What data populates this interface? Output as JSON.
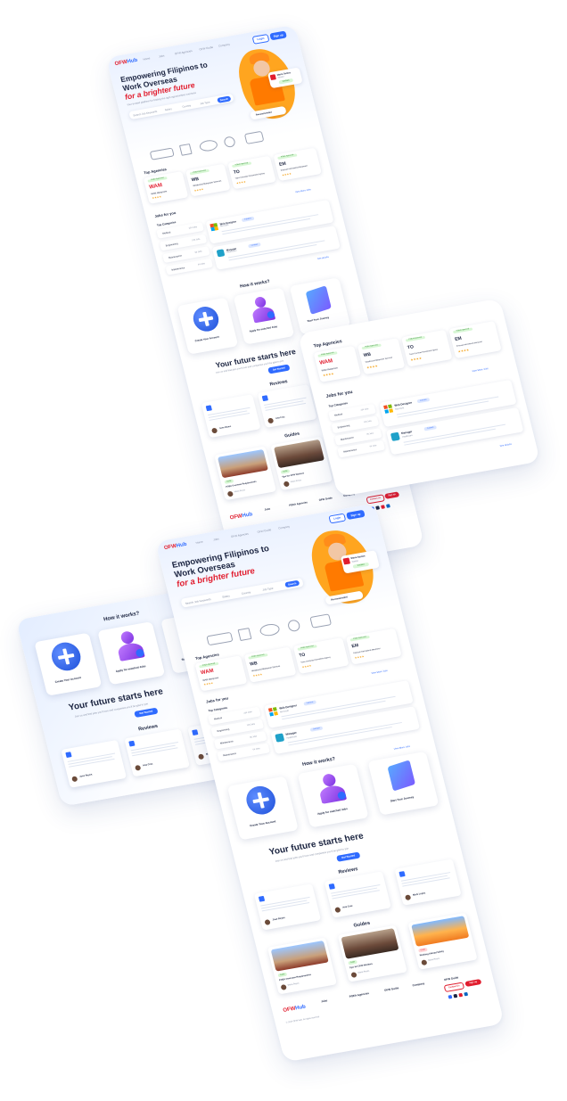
{
  "site": {
    "logo_text_a": "OFW",
    "logo_text_b": "Hub",
    "nav": [
      "Home",
      "Jobs",
      "OFW Agencies",
      "OFW Guide",
      "Company"
    ],
    "login_label": "Login",
    "signup_label": "Sign up"
  },
  "hero": {
    "title_line1": "Empowering Filipinos to",
    "title_line2": "Work Overseas",
    "title_line3": "for a brighter future",
    "subtitle": "Your trusted platform for finding the right opportunities overseas",
    "search_placeholder": "Search Job Keywords",
    "search_filters": [
      "Salary",
      "Country",
      "Job Type"
    ],
    "search_button": "Search",
    "profile_card_name": "Maria Santos",
    "profile_card_role": "Welder",
    "profile_card_tag": "Verified",
    "recommended_label": "Recommended"
  },
  "top_agencies": {
    "heading": "Top Agencies",
    "agencies": [
      {
        "name": "WAM Manpower",
        "tag": "POEA Approved",
        "rating": "4.8",
        "logo": "WAM"
      },
      {
        "name": "Westbound Manpower Services",
        "tag": "POEA Approved",
        "rating": "4.7",
        "logo": "WB"
      },
      {
        "name": "Trans Overseas Recruitment Agency",
        "tag": "POEA Approved",
        "rating": "4.6",
        "logo": "TO"
      },
      {
        "name": "Emanuel International Manpower",
        "tag": "POEA Approved",
        "rating": "4.5",
        "logo": "EM"
      }
    ]
  },
  "jobs": {
    "heading": "Jobs for you",
    "view_more": "View More Jobs",
    "categories_heading": "Top Categories",
    "categories": [
      {
        "name": "Medical",
        "count": "234 Jobs"
      },
      {
        "name": "Engineering",
        "count": "128 Jobs"
      },
      {
        "name": "Maintenance",
        "count": "96 Jobs"
      },
      {
        "name": "Maintenance",
        "count": "64 Jobs"
      }
    ],
    "listings": [
      {
        "title": "Web Designer",
        "company": "Microsoft",
        "tag": "Full-time"
      },
      {
        "title": "Manager",
        "company": "Healthcare",
        "tag": "Contract"
      }
    ],
    "see_all": "See all jobs"
  },
  "how": {
    "heading": "How it works?",
    "steps": [
      "Create Your Account",
      "Apply for matched Jobs",
      "Start Your Journey"
    ]
  },
  "future": {
    "heading": "Your future starts here",
    "subheading": "Join us and find jobs you'll love and companies you'll be glad to join",
    "button": "Get Started"
  },
  "reviews": {
    "heading": "Reviews",
    "items": [
      {
        "author": "Jose Reyes",
        "role": "OFW"
      },
      {
        "author": "Ana Cruz",
        "role": "OFW"
      },
      {
        "author": "Mark Lopez",
        "role": "OFW"
      }
    ]
  },
  "guides": {
    "heading": "Guides",
    "items": [
      {
        "title": "POEA Overseas Requirements",
        "author": "Maria Reyes",
        "tag": "Guide"
      },
      {
        "title": "Tips for OFW Workers",
        "author": "Maria Reyes",
        "tag": "Guide"
      },
      {
        "title": "Working Abroad Safety",
        "author": "Maria Reyes",
        "tag": "Guide"
      }
    ]
  },
  "footer": {
    "cols": [
      "Jobs",
      "POEA Agencies",
      "OFW Guide",
      "Company",
      "OFW Guide"
    ],
    "copyright": "© 2024 OFW Hub. All rights reserved",
    "contact_button": "Contact Us",
    "signup_button": "Sign up"
  },
  "colors": {
    "brand_blue": "#2f6bff",
    "brand_red": "#e11d2e",
    "accent_orange": "#ffa51f"
  }
}
